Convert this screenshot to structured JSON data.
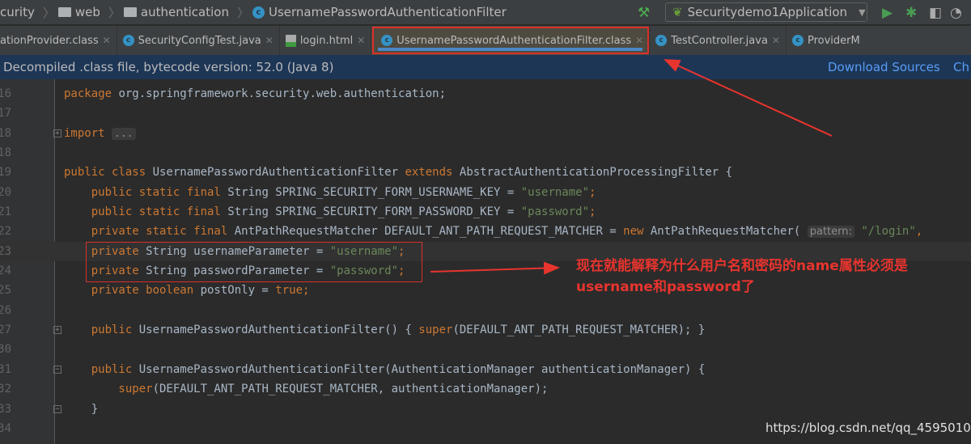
{
  "breadcrumb": [
    "curity",
    "web",
    "authentication",
    "UsernamePasswordAuthenticationFilter"
  ],
  "run_config": "Securitydemo1Application",
  "tabs": [
    {
      "label": "ationProvider.class",
      "icon": "class-icon"
    },
    {
      "label": "SecurityConfigTest.java",
      "icon": "class-icon"
    },
    {
      "label": "login.html",
      "icon": "html-icon"
    },
    {
      "label": "UsernamePasswordAuthenticationFilter.class",
      "icon": "class-locked-icon",
      "active": true
    },
    {
      "label": "TestController.java",
      "icon": "class-icon"
    },
    {
      "label": "ProviderM",
      "icon": "class-locked-icon"
    }
  ],
  "banner": {
    "text": "Decompiled .class file, bytecode version: 52.0 (Java 8)",
    "download": "Download Sources",
    "choose": "Ch"
  },
  "code": [
    {
      "ln": "16",
      "tokens": [
        [
          "kw",
          "package "
        ],
        [
          "",
          "org.springframework.security.web.authentication;"
        ]
      ]
    },
    {
      "ln": "17",
      "tokens": []
    },
    {
      "ln": "18",
      "fold": "+",
      "tokens": [
        [
          "kw",
          "import "
        ],
        [
          "hint2",
          "..."
        ]
      ]
    },
    {
      "ln": "18",
      "tokens": []
    },
    {
      "ln": "19",
      "tokens": [
        [
          "kw",
          "public class "
        ],
        [
          "",
          "UsernamePasswordAuthenticationFilter "
        ],
        [
          "kw",
          "extends "
        ],
        [
          "",
          "AbstractAuthenticationProcessingFilter {"
        ]
      ]
    },
    {
      "ln": "20",
      "tokens": [
        [
          "kw",
          "    public static final "
        ],
        [
          "",
          "String SPRING_SECURITY_FORM_USERNAME_KEY = "
        ],
        [
          "str",
          "\"username\""
        ],
        [
          "kw",
          ";"
        ]
      ]
    },
    {
      "ln": "21",
      "tokens": [
        [
          "kw",
          "    public static final "
        ],
        [
          "",
          "String SPRING_SECURITY_FORM_PASSWORD_KEY = "
        ],
        [
          "str",
          "\"password\""
        ],
        [
          "kw",
          ";"
        ]
      ]
    },
    {
      "ln": "22",
      "tokens": [
        [
          "kw",
          "    private static final "
        ],
        [
          "",
          "AntPathRequestMatcher DEFAULT_ANT_PATH_REQUEST_MATCHER = "
        ],
        [
          "kw",
          "new "
        ],
        [
          "",
          "AntPathRequestMatcher( "
        ],
        [
          "hint",
          "pattern:"
        ],
        [
          "str",
          " \"/login\""
        ],
        [
          "kw",
          ", "
        ]
      ]
    },
    {
      "ln": "23",
      "cur": true,
      "tokens": [
        [
          "kw",
          "    private "
        ],
        [
          "",
          "String usernameParameter = "
        ],
        [
          "str",
          "\"username\""
        ],
        [
          "kw",
          ";"
        ]
      ]
    },
    {
      "ln": "24",
      "tokens": [
        [
          "kw",
          "    private "
        ],
        [
          "",
          "String passwordParameter = "
        ],
        [
          "str",
          "\"password\""
        ],
        [
          "kw",
          ";"
        ]
      ]
    },
    {
      "ln": "25",
      "tokens": [
        [
          "kw",
          "    private boolean "
        ],
        [
          "",
          "postOnly = "
        ],
        [
          "kw",
          "true;"
        ]
      ]
    },
    {
      "ln": "26",
      "tokens": []
    },
    {
      "ln": "27",
      "fold": "+",
      "tokens": [
        [
          "kw",
          "    public "
        ],
        [
          "",
          "UsernamePasswordAuthenticationFilter() { "
        ],
        [
          "kw",
          "super"
        ],
        [
          "",
          "(DEFAULT_ANT_PATH_REQUEST_MATCHER); }"
        ]
      ]
    },
    {
      "ln": "30",
      "tokens": []
    },
    {
      "ln": "31",
      "fold": "-",
      "tokens": [
        [
          "kw",
          "    public "
        ],
        [
          "",
          "UsernamePasswordAuthenticationFilter(AuthenticationManager authenticationManager) {"
        ]
      ]
    },
    {
      "ln": "32",
      "tokens": [
        [
          "kw",
          "        super"
        ],
        [
          "",
          "(DEFAULT_ANT_PATH_REQUEST_MATCHER, authenticationManager);"
        ]
      ]
    },
    {
      "ln": "33",
      "fold": "-",
      "tokens": [
        [
          "",
          "    }"
        ]
      ]
    },
    {
      "ln": "34",
      "tokens": []
    }
  ],
  "annotation": {
    "line1": "现在就能解释为什么用户名和密码的name属性必须是",
    "line2": "username和password了",
    "color": "#e8342e"
  },
  "watermark": "https://blog.csdn.net/qq_45950109",
  "colors": {
    "keyword": "#cc7832",
    "string": "#6a8759",
    "text": "#a9b7c6",
    "background": "#2b2b2b",
    "highlight": "#d9302b"
  }
}
